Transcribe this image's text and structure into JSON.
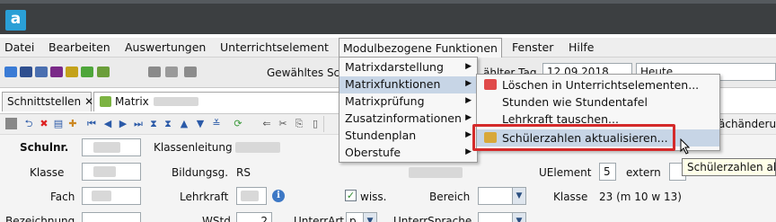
{
  "window": {
    "app_icon_letter": "a"
  },
  "menubar": {
    "items": [
      "Datei",
      "Bearbeiten",
      "Auswertungen",
      "Unterrichtselement",
      "Modulbezogene Funktionen",
      "Fenster",
      "Hilfe"
    ]
  },
  "toolbar": {
    "selected_label": "Gewähltes Sch",
    "day_label": "ählter Tag",
    "date_value": "12.09.2018",
    "today_value": "Heute"
  },
  "tabs": [
    {
      "label": "Schnittstellen",
      "close": "✕"
    },
    {
      "label": "Matrix",
      "close": "✕"
    }
  ],
  "right_hint": "ächänderun",
  "form": {
    "schulnr_label": "Schulnr.",
    "klassenleitung_label": "Klassenleitung",
    "klasse_label": "Klasse",
    "bildungsg_label": "Bildungsg.",
    "bildungsg_value": "RS",
    "fach_label": "Fach",
    "lehrkraft_label": "Lehrkraft",
    "wiss_label": "wiss.",
    "bereich_label": "Bereich",
    "uelement_label": "UElement",
    "uelement_value": "5",
    "extern_label": "extern",
    "klasse_right_label": "Klasse",
    "klasse_right_value": "23 (m 10 w 13)",
    "bezeichnung_label": "Bezeichnung",
    "wstd_label": "WStd",
    "wstd_value": "2",
    "unterrart_label": "UnterrArt",
    "unterrart_value": "p",
    "unterrsprache_label": "UnterrSprache"
  },
  "module_menu": {
    "items": [
      "Matrixdarstellung",
      "Matrixfunktionen",
      "Matrixprüfung",
      "Zusatzinformationen",
      "Stundenplan",
      "Oberstufe"
    ],
    "selected_index": 1
  },
  "matrix_submenu": {
    "items": [
      "Löschen in Unterrichtselementen...",
      "Stunden wie Stundentafel",
      "Lehrkraft tauschen...",
      "Schülerzahlen aktualisieren..."
    ],
    "selected_index": 3
  },
  "tooltip": {
    "text": "Schülerzahlen akt"
  },
  "colors": {
    "highlight": "#d42a2a",
    "selection": "#c7d5e6",
    "titlebar": "#3c3f41"
  }
}
